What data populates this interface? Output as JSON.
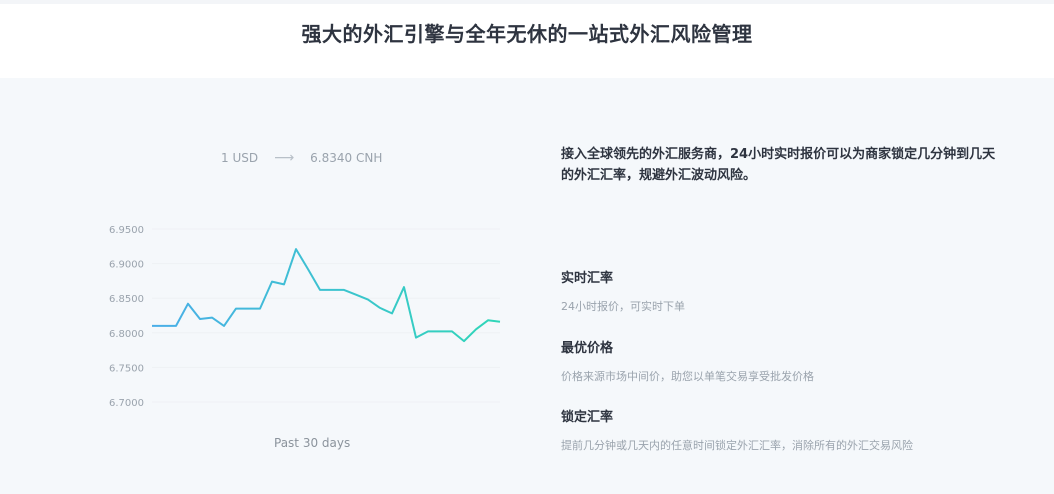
{
  "headline": "强大的外汇引擎与全年无休的一站式外汇风险管理",
  "rate": {
    "from": "1 USD",
    "arrow": "⟶",
    "to": "6.8340 CNH"
  },
  "chart_caption": "Past 30 days",
  "intro": "接入全球领先的外汇服务商，24小时实时报价可以为商家锁定几分钟到几天的外汇汇率，规避外汇波动风险。",
  "features": [
    {
      "title": "实时汇率",
      "desc": "24小时报价，可实时下单"
    },
    {
      "title": "最优价格",
      "desc": "价格来源市场中间价，助您以单笔交易享受批发价格"
    },
    {
      "title": "锁定汇率",
      "desc": "提前几分钟或几天内的任意时间锁定外汇汇率，消除所有的外汇交易风险"
    }
  ],
  "colors": {
    "line_start": "#4aaee8",
    "line_end": "#2fd6b8",
    "grid": "#eef1f4"
  },
  "chart_data": {
    "type": "line",
    "title": "",
    "xlabel": "Past 30 days",
    "ylabel": "",
    "ylim": [
      6.68,
      6.96
    ],
    "y_ticks": [
      "6.9500",
      "6.9000",
      "6.8500",
      "6.8000",
      "6.7500",
      "6.7000"
    ],
    "x": [
      1,
      2,
      3,
      4,
      5,
      6,
      7,
      8,
      9,
      10,
      11,
      12,
      13,
      14,
      15,
      16,
      17,
      18,
      19,
      20,
      21,
      22,
      23,
      24,
      25,
      26,
      27,
      28,
      29,
      30
    ],
    "values": [
      6.81,
      6.81,
      6.81,
      6.842,
      6.82,
      6.822,
      6.81,
      6.835,
      6.835,
      6.835,
      6.874,
      6.87,
      6.921,
      6.892,
      6.862,
      6.862,
      6.862,
      6.855,
      6.848,
      6.836,
      6.828,
      6.866,
      6.793,
      6.802,
      6.802,
      6.802,
      6.788,
      6.805,
      6.818,
      6.816
    ]
  }
}
